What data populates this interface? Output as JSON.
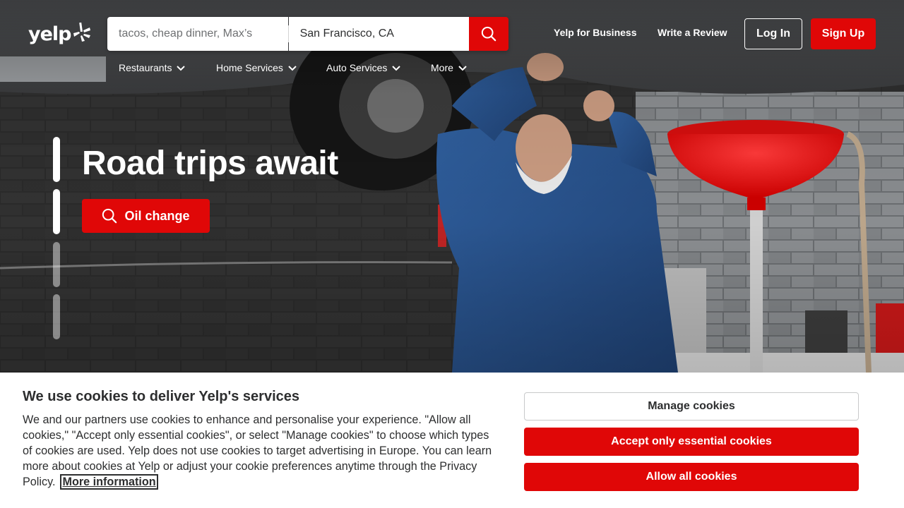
{
  "brand": {
    "logo_text": "yelp",
    "accent": "#e00707"
  },
  "search": {
    "find_placeholder": "tacos, cheap dinner, Max’s",
    "near_value": "San Francisco, CA",
    "button_icon": "search-icon"
  },
  "header": {
    "links": {
      "business": "Yelp for Business",
      "review": "Write a Review"
    },
    "login_label": "Log In",
    "signup_label": "Sign Up"
  },
  "categories": [
    {
      "label": "Restaurants",
      "icon": "chevron-down-icon"
    },
    {
      "label": "Home Services",
      "icon": "chevron-down-icon"
    },
    {
      "label": "Auto Services",
      "icon": "chevron-down-icon"
    },
    {
      "label": "More",
      "icon": "chevron-down-icon"
    }
  ],
  "hero": {
    "title": "Road trips await",
    "cta_label": "Oil change",
    "cta_icon": "search-icon",
    "slides_total": 4,
    "slide_active": 2
  },
  "cookie_banner": {
    "title": "We use cookies to deliver Yelp's services",
    "body": "We and our partners use cookies to enhance and personalise your experience. \"Allow all cookies,\" \"Accept only essential cookies\", or select \"Manage cookies\" to choose which types of cookies are used. Yelp does not use cookies to target advertising in Europe. You can learn more about cookies at Yelp or adjust your cookie preferences anytime through the Privacy Policy.",
    "more_link": "More information",
    "buttons": {
      "manage": "Manage cookies",
      "essential": "Accept only essential cookies",
      "allow": "Allow all cookies"
    }
  }
}
